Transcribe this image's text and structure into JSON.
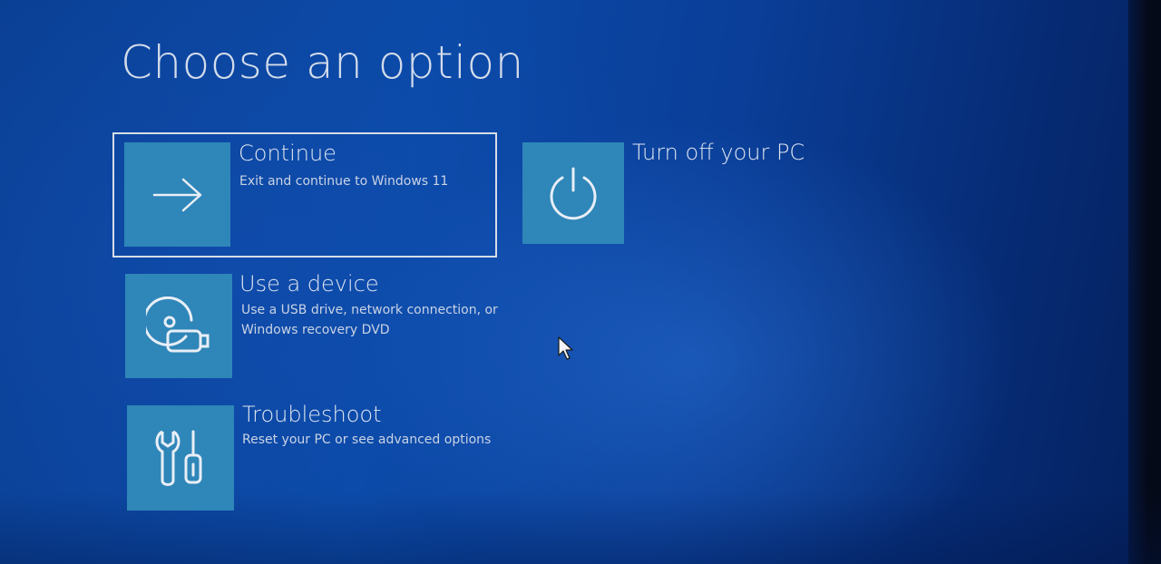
{
  "screen": {
    "title": "Choose an option"
  },
  "options": {
    "continue": {
      "label": "Continue",
      "description": "Exit and continue to Windows 11",
      "icon": "arrow-right-icon",
      "selected": true
    },
    "use_device": {
      "label": "Use a device",
      "description": "Use a USB drive, network connection, or Windows recovery DVD",
      "icon": "usb-disc-icon"
    },
    "troubleshoot": {
      "label": "Troubleshoot",
      "description": "Reset your PC or see advanced options",
      "icon": "tools-icon"
    },
    "turn_off": {
      "label": "Turn off your PC",
      "icon": "power-icon"
    }
  },
  "colors": {
    "background": "#0b4aa8",
    "tile": "#2f86b8",
    "text": "#dfe6f0",
    "focus_border": "#d6dde8"
  }
}
